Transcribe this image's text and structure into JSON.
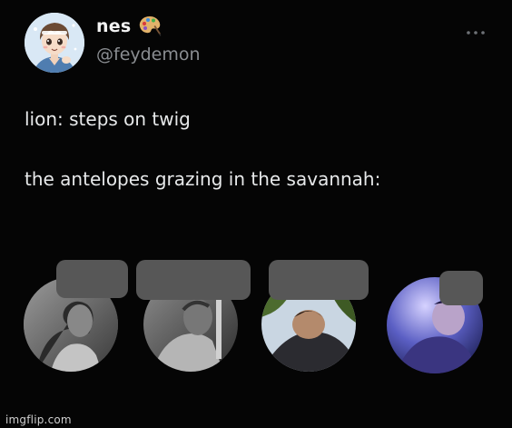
{
  "author": {
    "display_name": "nes",
    "handle": "@feydemon",
    "name_emoji_icon": "artist-palette-icon",
    "avatar_icon": "anime-avatar-icon"
  },
  "menu_icon": "more-horizontal-icon",
  "tweet": {
    "line1": "lion: steps on twig",
    "line2": "the antelopes grazing in the savannah:"
  },
  "photos": [
    {
      "name": "photo-1",
      "tone": "grayscale"
    },
    {
      "name": "photo-2",
      "tone": "grayscale"
    },
    {
      "name": "photo-3",
      "tone": "color-sky"
    },
    {
      "name": "photo-4",
      "tone": "color-blue"
    }
  ],
  "watermark": "imgflip.com",
  "colors": {
    "background": "#050505",
    "text": "#e7e9ea",
    "secondary_text": "#8a8d91",
    "redaction": "#575757"
  }
}
